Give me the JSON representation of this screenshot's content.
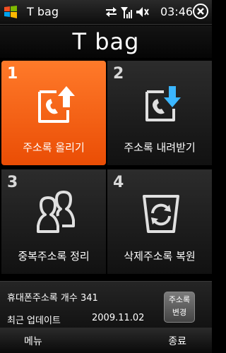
{
  "status_bar": {
    "app_name": "T bag",
    "clock": "03:46",
    "icons": [
      "windows-logo-icon",
      "data-transfer-icon",
      "signal-icon",
      "volume-icon",
      "close-icon"
    ]
  },
  "title": "T bag",
  "tiles": [
    {
      "number": "1",
      "label": "주소록 올리기",
      "icon": "upload-contacts-icon"
    },
    {
      "number": "2",
      "label": "주소록 내려받기",
      "icon": "download-contacts-icon"
    },
    {
      "number": "3",
      "label": "중복주소록 정리",
      "icon": "duplicate-contacts-icon"
    },
    {
      "number": "4",
      "label": "삭제주소록 복원",
      "icon": "restore-contacts-icon"
    }
  ],
  "info": {
    "count_label": "휴대폰주소록 개수",
    "count_value": "341",
    "updated_label": "최근 업데이트",
    "updated_value": "2009.11.02",
    "button_line1": "주소록",
    "button_line2": "변경"
  },
  "softkeys": {
    "left": "메뉴",
    "right": "종료"
  },
  "colors": {
    "accent": "#f36a1a",
    "background": "#000000"
  }
}
